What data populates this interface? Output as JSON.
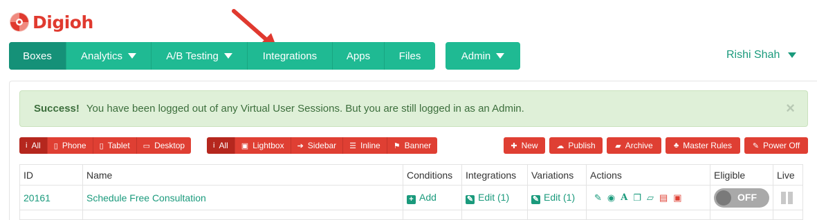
{
  "brand": {
    "name": "Digioh",
    "color": "#e03a2f"
  },
  "nav": {
    "items": [
      {
        "label": "Boxes",
        "has_caret": false,
        "active": true
      },
      {
        "label": "Analytics",
        "has_caret": true
      },
      {
        "label": "A/B Testing",
        "has_caret": true
      },
      {
        "label": "Integrations",
        "has_caret": false
      },
      {
        "label": "Apps",
        "has_caret": false
      },
      {
        "label": "Files",
        "has_caret": false
      }
    ],
    "admin_label": "Admin",
    "user_name": "Rishi Shah",
    "accent": "#1fba93"
  },
  "alert": {
    "title": "Success!",
    "message": "You have been logged out of any Virtual User Sessions. But you are still logged in as an Admin.",
    "close": "×"
  },
  "device_filters": [
    {
      "label": "All",
      "icon": "info-icon",
      "active": true
    },
    {
      "label": "Phone",
      "icon": "phone-icon"
    },
    {
      "label": "Tablet",
      "icon": "tablet-icon"
    },
    {
      "label": "Desktop",
      "icon": "desktop-icon"
    }
  ],
  "type_filters": [
    {
      "label": "All",
      "icon": "info-icon",
      "active": true
    },
    {
      "label": "Lightbox",
      "icon": "lightbox-icon"
    },
    {
      "label": "Sidebar",
      "icon": "sidebar-icon"
    },
    {
      "label": "Inline",
      "icon": "inline-icon"
    },
    {
      "label": "Banner",
      "icon": "flag-icon"
    }
  ],
  "actions": [
    {
      "label": "New",
      "icon": "plus-icon"
    },
    {
      "label": "Publish",
      "icon": "cloud-upload-icon"
    },
    {
      "label": "Archive",
      "icon": "folder-icon"
    },
    {
      "label": "Master Rules",
      "icon": "sitemap-icon"
    },
    {
      "label": "Power Off",
      "icon": "power-icon"
    }
  ],
  "table": {
    "headers": [
      "ID",
      "Name",
      "Conditions",
      "Integrations",
      "Variations",
      "Actions",
      "Eligible",
      "Live"
    ],
    "rows": [
      {
        "id": "20161",
        "name": "Schedule Free Consultation",
        "conditions": "Add",
        "integrations": "Edit (1)",
        "variations": "Edit (1)",
        "eligible": "OFF"
      }
    ]
  }
}
